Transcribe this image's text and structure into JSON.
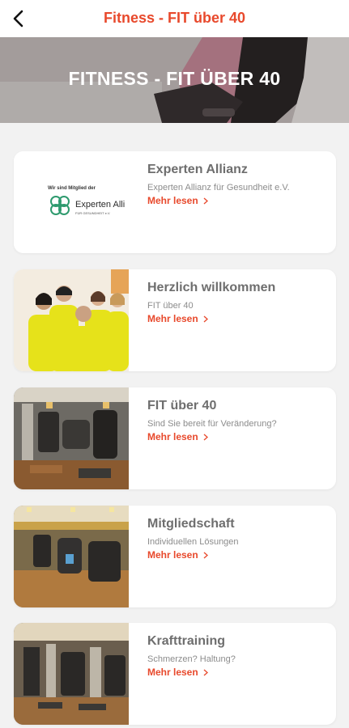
{
  "header": {
    "title": "Fitness - FIT über 40"
  },
  "hero": {
    "title": "FITNESS - FIT ÜBER 40"
  },
  "cards": [
    {
      "title": "Experten Allianz",
      "subtitle": "Experten Allianz für Gesundheit e.V.",
      "more": "Mehr lesen",
      "logo_caption": "Wir sind Mitglied der",
      "logo_name": "Experten Alli",
      "logo_tagline": "FÜR GESUNDHEIT e.V."
    },
    {
      "title": "Herzlich willkommen",
      "subtitle": "FIT über 40",
      "more": "Mehr lesen"
    },
    {
      "title": "FIT über 40",
      "subtitle": "Sind Sie bereit für Veränderung?",
      "more": "Mehr lesen"
    },
    {
      "title": "Mitgliedschaft",
      "subtitle": "Individuellen Lösungen",
      "more": "Mehr lesen"
    },
    {
      "title": "Krafttraining",
      "subtitle": "Schmerzen? Haltung?",
      "more": "Mehr lesen"
    }
  ],
  "colors": {
    "accent": "#e8492c",
    "background": "#f2f2f2",
    "card": "#ffffff",
    "title_grey": "#6e6e6e",
    "logo_green": "#2e9a6e",
    "shirt_yellow": "#e6e21a"
  },
  "icons": {
    "back": "chevron-left-icon",
    "more": "chevron-right-icon",
    "logo": "experten-allianz-logo-icon"
  }
}
